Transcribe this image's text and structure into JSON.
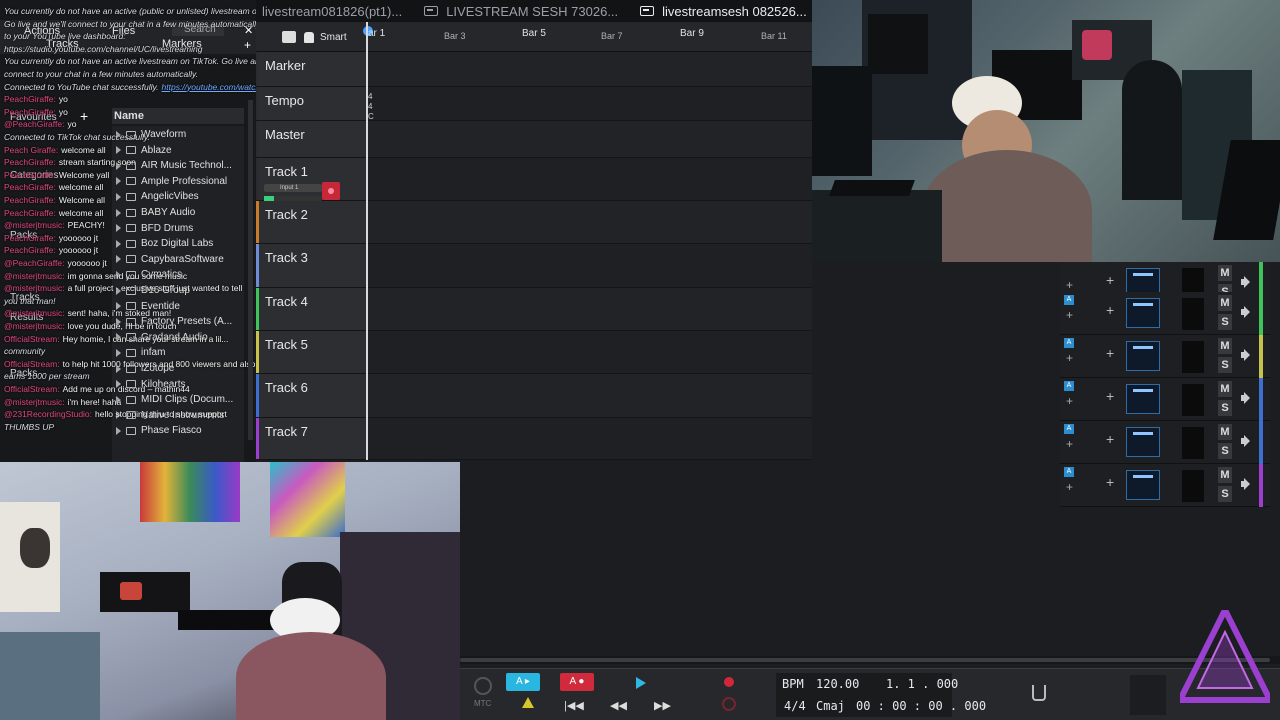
{
  "tabs": [
    {
      "label": "livestream081826(pt1)...",
      "active": false
    },
    {
      "label": "LIVESTREAM SESH 73026...",
      "active": false
    },
    {
      "label": "livestreamsesh 082526...",
      "active": true
    }
  ],
  "toolbar": {
    "smart_label": "Smart"
  },
  "ruler": {
    "major": [
      {
        "label": "ar 1"
      },
      {
        "label": "Bar 5"
      },
      {
        "label": "Bar 9"
      }
    ],
    "minor": [
      {
        "label": "Bar 3"
      },
      {
        "label": "Bar 7"
      },
      {
        "label": "Bar 11"
      }
    ]
  },
  "tracks": [
    {
      "name": "Marker",
      "color": "#2a2c2f"
    },
    {
      "name": "Tempo",
      "color": "#2a2c2f"
    },
    {
      "name": "Master",
      "color": "#2a2c2f"
    },
    {
      "name": "Track 1",
      "color": "#2a2c2f",
      "input": "Input 1"
    },
    {
      "name": "Track 2",
      "color": "#c77b2b"
    },
    {
      "name": "Track 3",
      "color": "#6b8ed6"
    },
    {
      "name": "Track 4",
      "color": "#3fc45a"
    },
    {
      "name": "Track 5",
      "color": "#c7c24a"
    },
    {
      "name": "Track 6",
      "color": "#3d6fd0"
    },
    {
      "name": "Track 7",
      "color": "#9b3fd0"
    }
  ],
  "tempo_marks": [
    "4",
    "4",
    "C"
  ],
  "mixer": {
    "mute_label": "M",
    "solo_label": "S",
    "mini_label": "A",
    "plus_label": "+",
    "row_colors": [
      "#3fc45a",
      "#3fc45a",
      "#c7c24a",
      "#3d6fd0",
      "#3d6fd0",
      "#9b3fd0"
    ]
  },
  "transport": {
    "bpm_label": "BPM",
    "bpm_value": "120.00",
    "position": "1. 1 . 000",
    "time_sig": "4/4",
    "key": "Cmaj",
    "time": "00 : 00 : 00 . 000",
    "mtc_label": "MTC",
    "loop_label": "A",
    "punch_label": "A"
  },
  "left_panel": {
    "actions_label": "Actions",
    "files_label": "Files",
    "tracks_label": "Tracks",
    "markers_label": "Markers",
    "search_placeholder": "Search",
    "name_header": "Name",
    "categories": [
      "Favourites",
      "Categories",
      "Packs",
      "Tracks",
      "Results",
      "Packs"
    ],
    "browser_items": [
      "Waveform",
      "Ablaze",
      "AIR Music Technol...",
      "Ample Professional",
      "AngelicVibes",
      "BABY Audio",
      "BFD Drums",
      "Boz Digital Labs",
      "CapybaraSoftware",
      "Cymatics",
      "D16 Group",
      "Eventide",
      "Factory Presets (A...",
      "Gradand Audio",
      "infam",
      "iZotope",
      "Kilohearts",
      "MIDI Clips (Docum...",
      "Native Instruments",
      "Phase Fiasco"
    ]
  },
  "chat": [
    {
      "sys": "You currently do not have an active (public or unlisted) livestream on YouTube."
    },
    {
      "sys": "Go live and we'll connect to your chat in a few minutes automatically. Click here to go"
    },
    {
      "sys": "to your YouTube live dashboard:"
    },
    {
      "sys": "https://studio.youtube.com/channel/UC/livestreaming"
    },
    {
      "sys": "You currently do not have an active livestream on TikTok. Go live and we'll"
    },
    {
      "sys": "connect to your chat in a few minutes automatically."
    },
    {
      "sys": "Connected to YouTube chat successfully.",
      "link": "https://youtube.com/watch?"
    },
    {
      "user": "PeachGiraffe:",
      "msg": "yo"
    },
    {
      "user": "PeachGiraffe:",
      "msg": "yo"
    },
    {
      "user": "@PeachGiraffe:",
      "msg": "yo"
    },
    {
      "sys": "Connected to TikTok chat successfully."
    },
    {
      "user": "Peach Giraffe:",
      "msg": "welcome all"
    },
    {
      "user": "PeachGiraffe:",
      "msg": "stream starting soon"
    },
    {
      "user": "PeachGiraffe:",
      "msg": "Welcome yall"
    },
    {
      "user": "PeachGiraffe:",
      "msg": "welcome all"
    },
    {
      "user": "PeachGiraffe:",
      "msg": "Welcome all"
    },
    {
      "user": "PeachGiraffe:",
      "msg": "welcome all"
    },
    {
      "user": "@misterjtmusic:",
      "msg": "PEACHY!"
    },
    {
      "user": "PeachGiraffe:",
      "msg": "yoooooo jt"
    },
    {
      "user": "PeachGiraffe:",
      "msg": "yoooooo jt"
    },
    {
      "user": "@PeachGiraffe:",
      "msg": "yoooooo jt"
    },
    {
      "user": "@misterjtmusic:",
      "msg": "im gonna send you some music"
    },
    {
      "user": "@misterjtmusic:",
      "msg": "a full project - exclusive stuff just wanted to tell"
    },
    {
      "sys": "you that man!"
    },
    {
      "user": "@misterjtmusic:",
      "msg": "sent! haha, i'm stoked man!"
    },
    {
      "user": "@misterjtmusic:",
      "msg": "love you dude, i'll be in touch"
    },
    {
      "user": "OfficialStream:",
      "msg": "Hey homie, I can share your stream in a lil..."
    },
    {
      "sys": "community"
    },
    {
      "user": "OfficialStream:",
      "msg": "to help hit 1000 followers and 800 viewers and also"
    },
    {
      "sys": "earns 1000 per stream"
    },
    {
      "user": "OfficialStream:",
      "msg": "Add me up on discord – mathin44"
    },
    {
      "user": "@misterjtmusic:",
      "msg": "i'm here! haha"
    },
    {
      "user": "@231RecordingStudio:",
      "msg": "hello stopping thru to show support"
    },
    {
      "sys": "THUMBS UP"
    }
  ]
}
